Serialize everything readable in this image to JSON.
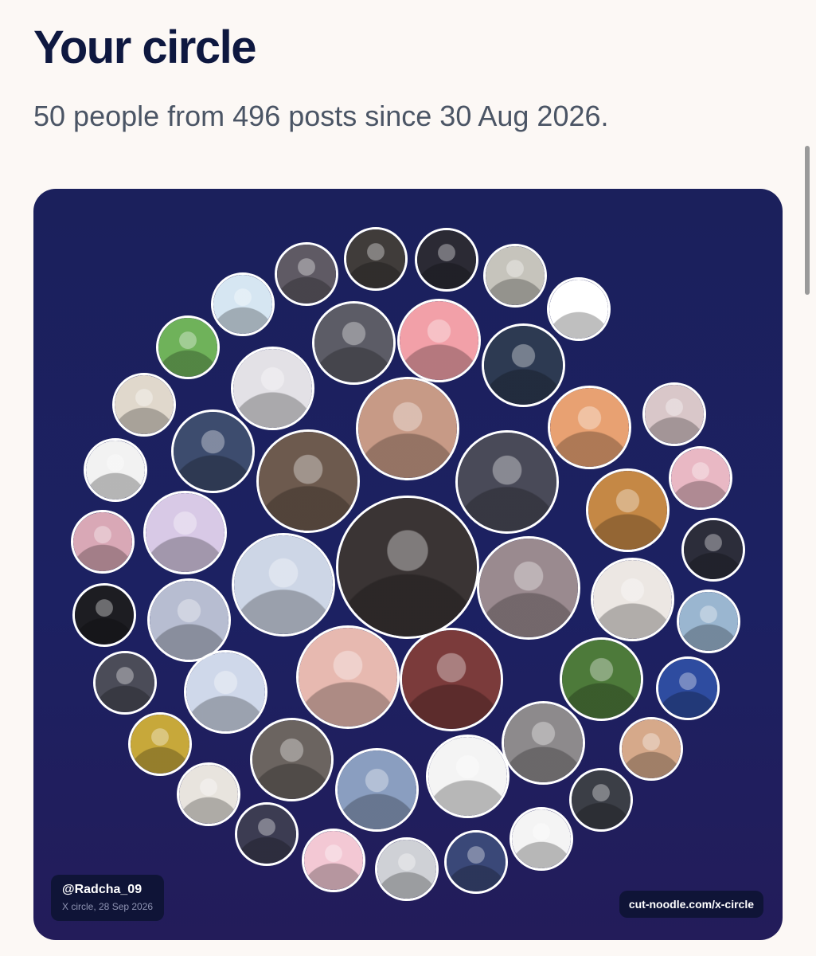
{
  "header": {
    "title": "Your circle",
    "subtitle": "50 people from 496 posts since 30 Aug 2026."
  },
  "card": {
    "handle": "@Radcha_09",
    "caption": "X circle, 28 Sep 2026",
    "site": "cut-noodle.com/x-circle"
  },
  "avatars": [
    {
      "tone": "#3a3434"
    },
    {
      "tone": "#c79a86"
    },
    {
      "tone": "#494a58"
    },
    {
      "tone": "#9a8a8f"
    },
    {
      "tone": "#7b3b3b"
    },
    {
      "tone": "#e7b9b0"
    },
    {
      "tone": "#cdd6e6"
    },
    {
      "tone": "#6d5a4e"
    },
    {
      "tone": "#e3e1e6"
    },
    {
      "tone": "#5c5c66"
    },
    {
      "tone": "#f2a0a8"
    },
    {
      "tone": "#2d3a52"
    },
    {
      "tone": "#e8a172"
    },
    {
      "tone": "#c58845"
    },
    {
      "tone": "#ece7e3"
    },
    {
      "tone": "#4d7a3a"
    },
    {
      "tone": "#8d8a8c"
    },
    {
      "tone": "#f4f4f4"
    },
    {
      "tone": "#8a9ec0"
    },
    {
      "tone": "#6b6460"
    },
    {
      "tone": "#cfd8ea"
    },
    {
      "tone": "#b7bdd1"
    },
    {
      "tone": "#d8c9e6"
    },
    {
      "tone": "#3d4c6e"
    },
    {
      "tone": "#d9c7c9"
    },
    {
      "tone": "#e9b8c4"
    },
    {
      "tone": "#2c2d3a"
    },
    {
      "tone": "#9ab6d0"
    },
    {
      "tone": "#2e4ca0"
    },
    {
      "tone": "#d6a98a"
    },
    {
      "tone": "#3b3e46"
    },
    {
      "tone": "#f4f4f4"
    },
    {
      "tone": "#3a4878"
    },
    {
      "tone": "#cfd1d6"
    },
    {
      "tone": "#f3c8d4"
    },
    {
      "tone": "#3c3c52"
    },
    {
      "tone": "#e8e4de"
    },
    {
      "tone": "#c7a83a"
    },
    {
      "tone": "#4b4c58"
    },
    {
      "tone": "#1d1d22"
    },
    {
      "tone": "#d9a8b6"
    },
    {
      "tone": "#f2f2f2"
    },
    {
      "tone": "#e0d8cc"
    },
    {
      "tone": "#6fb25a"
    },
    {
      "tone": "#d6e6f2"
    },
    {
      "tone": "#5f5a64"
    },
    {
      "tone": "#403c3a"
    },
    {
      "tone": "#2b2a34"
    },
    {
      "tone": "#c6c4bc"
    },
    {
      "tone": "#ffffff"
    }
  ]
}
